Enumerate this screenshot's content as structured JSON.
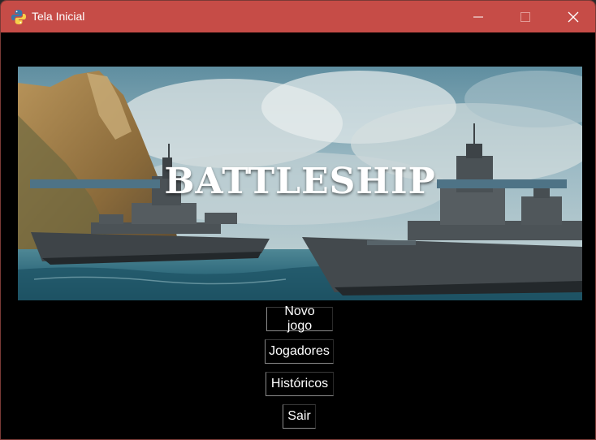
{
  "window": {
    "title": "Tela Inicial",
    "titlebar_color": "#c64c47",
    "controls": [
      "minimize-icon",
      "maximize-icon",
      "close-icon"
    ]
  },
  "banner": {
    "title": "BATTLESHIP",
    "bar_color": "#4e7386"
  },
  "menu": {
    "new_game": "Novo jogo",
    "players": "Jogadores",
    "history": "Históricos",
    "exit": "Sair"
  }
}
